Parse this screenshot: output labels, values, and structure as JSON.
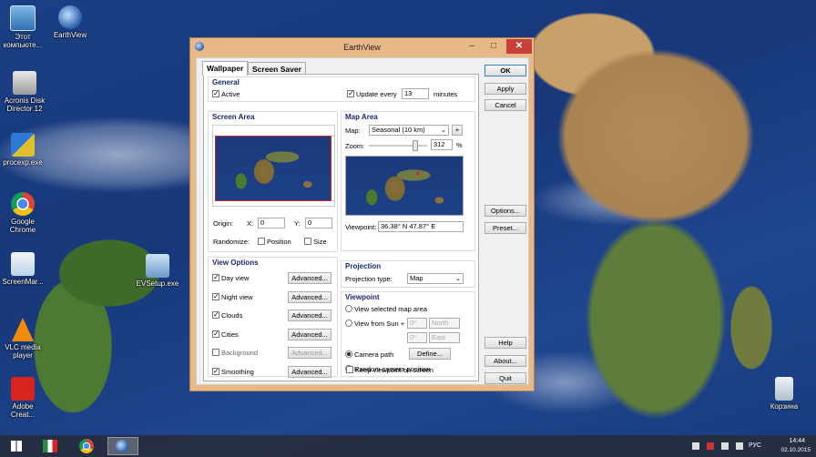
{
  "desktop": {
    "icons": [
      {
        "label": "Этот компьюте...",
        "icon": "computer-icon"
      },
      {
        "label": "EarthView",
        "icon": "earthview-icon"
      },
      {
        "label": "Acronis Disk Director 12",
        "icon": "acronis-icon"
      },
      {
        "label": "procexp.exe",
        "icon": "procexp-icon"
      },
      {
        "label": "Google Chrome",
        "icon": "chrome-icon"
      },
      {
        "label": "ScreenMar...",
        "icon": "screenmarker-icon"
      },
      {
        "label": "EVSetup.exe",
        "icon": "setup-icon"
      },
      {
        "label": "VLC media player",
        "icon": "vlc-icon"
      },
      {
        "label": "Adobe Creat...",
        "icon": "adobe-icon"
      },
      {
        "label": "Корзина",
        "icon": "recycle-bin-icon"
      }
    ]
  },
  "window": {
    "title": "EarthView",
    "tabs": [
      "Wallpaper",
      "Screen Saver"
    ],
    "general": {
      "title": "General",
      "active_label": "Active",
      "update_label": "Update every",
      "update_value": "13",
      "minutes_label": "minutes"
    },
    "screen_area": {
      "title": "Screen Area",
      "origin_label": "Origin:",
      "x_label": "X:",
      "x_value": "0",
      "y_label": "Y:",
      "y_value": "0",
      "randomize_label": "Randomize:",
      "position_label": "Position",
      "size_label": "Size"
    },
    "map_area": {
      "title": "Map Area",
      "map_label": "Map:",
      "map_value": "Seasonal (10 km)",
      "plus_label": "+",
      "zoom_label": "Zoom:",
      "zoom_value": "312",
      "zoom_unit": "%",
      "zoom_level": 0.78,
      "viewpoint_label": "Viewpoint:",
      "viewpoint_value": "36.38° N   47.87° E"
    },
    "projection": {
      "title": "Projection",
      "type_label": "Projection type:",
      "type_value": "Map"
    },
    "view_options": {
      "title": "View Options",
      "advanced_label": "Advanced...",
      "items": [
        {
          "label": "Day view",
          "checked": true,
          "enabled": true
        },
        {
          "label": "Night view",
          "checked": true,
          "enabled": true
        },
        {
          "label": "Clouds",
          "checked": true,
          "enabled": true
        },
        {
          "label": "Cities",
          "checked": true,
          "enabled": true
        },
        {
          "label": "Background",
          "checked": false,
          "enabled": false
        },
        {
          "label": "Smoothing",
          "checked": true,
          "enabled": true
        }
      ]
    },
    "viewpoint": {
      "title": "Viewpoint",
      "view_selected": "View selected map area",
      "view_from_sun": "View from Sun +",
      "sun_lat": "0°",
      "sun_lat_dir": "North",
      "sun_lon": "0°",
      "sun_lon_dir": "East",
      "camera_path": "Camera path",
      "define_label": "Define...",
      "random_camera": "Random camera position",
      "keep_viewpoint": "Keep viewpoint on screen"
    },
    "side_buttons": {
      "ok": "OK",
      "apply": "Apply",
      "cancel": "Cancel",
      "options": "Options...",
      "preset": "Preset...",
      "help": "Help",
      "about": "About...",
      "quit": "Quit"
    }
  },
  "taskbar": {
    "lang": "РУС",
    "time": "14:44",
    "date": "02.10.2015"
  }
}
